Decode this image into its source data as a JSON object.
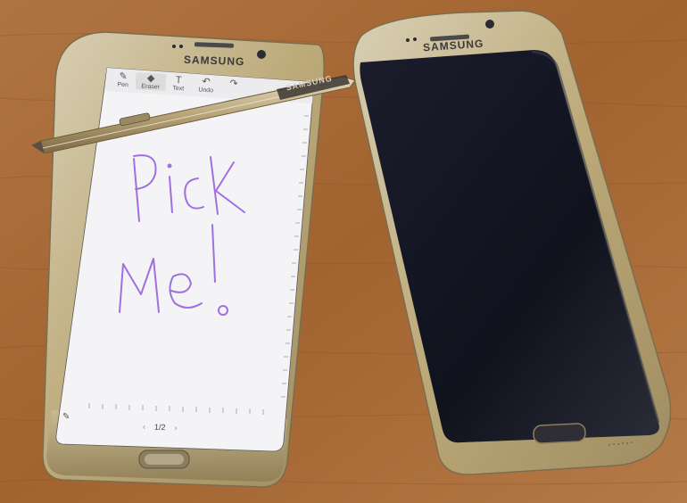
{
  "phone_left": {
    "brand": "SAMSUNG",
    "toolbar": [
      {
        "label": "Pen",
        "icon": "pen-icon",
        "glyph": "✎"
      },
      {
        "label": "Eraser",
        "icon": "eraser-icon",
        "glyph": "◆"
      },
      {
        "label": "Text",
        "icon": "text-icon",
        "glyph": "T"
      },
      {
        "label": "Undo",
        "icon": "undo-icon",
        "glyph": "↶"
      },
      {
        "label": "Redo",
        "icon": "redo-icon",
        "glyph": "↷"
      }
    ],
    "active_tool": "Eraser",
    "page_indicator": "1/2",
    "prev_glyph": "‹",
    "next_glyph": "›",
    "handwriting_color": "#a070e0"
  },
  "phone_right": {
    "brand": "SAMSUNG"
  },
  "stylus": {
    "brand": "SAMSUNG"
  },
  "colors": {
    "table": "#a8693a",
    "gold_frame": "#c9b98f",
    "screen_dark": "#151726",
    "note_paper": "#f4f4f6"
  }
}
